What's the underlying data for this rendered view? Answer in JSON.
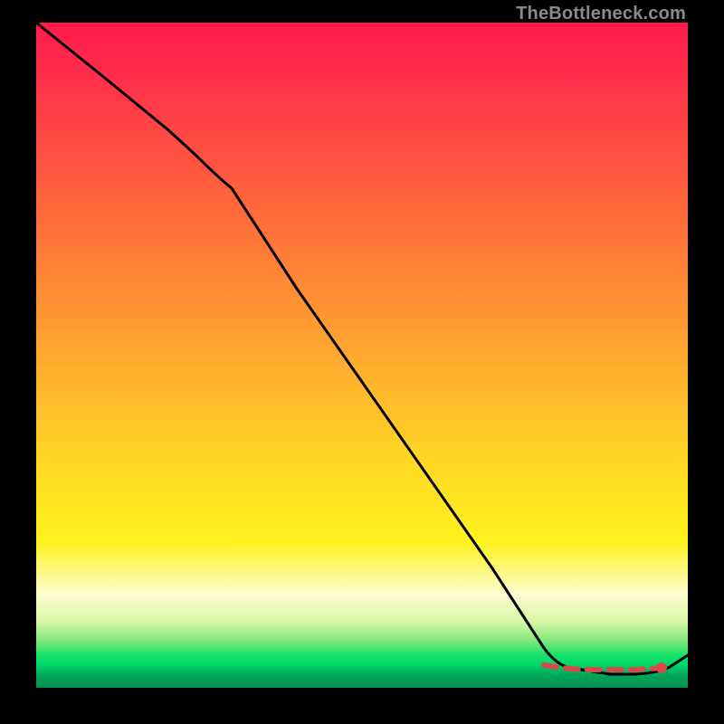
{
  "watermark": "TheBottleneck.com",
  "chart_data": {
    "type": "line",
    "title": "",
    "xlabel": "",
    "ylabel": "",
    "xlim": [
      0,
      100
    ],
    "ylim": [
      0,
      100
    ],
    "grid": false,
    "legend": false,
    "series": [
      {
        "name": "black-curve",
        "color": "#000000",
        "x": [
          0,
          10,
          20,
          25,
          30,
          40,
          50,
          60,
          70,
          78,
          82,
          88,
          92,
          97,
          100
        ],
        "values": [
          100,
          92,
          84,
          80,
          75,
          60,
          46,
          32,
          18,
          6,
          3,
          2,
          2,
          3,
          5
        ]
      },
      {
        "name": "red-dashed-flat",
        "color": "#d84a4a",
        "style": "dashed",
        "x": [
          78,
          80,
          82,
          84,
          86,
          88,
          90,
          92,
          94,
          96
        ],
        "values": [
          3,
          3,
          2.5,
          2.5,
          2.5,
          2.5,
          2.5,
          2.5,
          2.5,
          2.5
        ]
      }
    ],
    "markers": [
      {
        "name": "red-dot-end",
        "x": 96,
        "y": 3,
        "color": "#d84a4a"
      }
    ]
  }
}
